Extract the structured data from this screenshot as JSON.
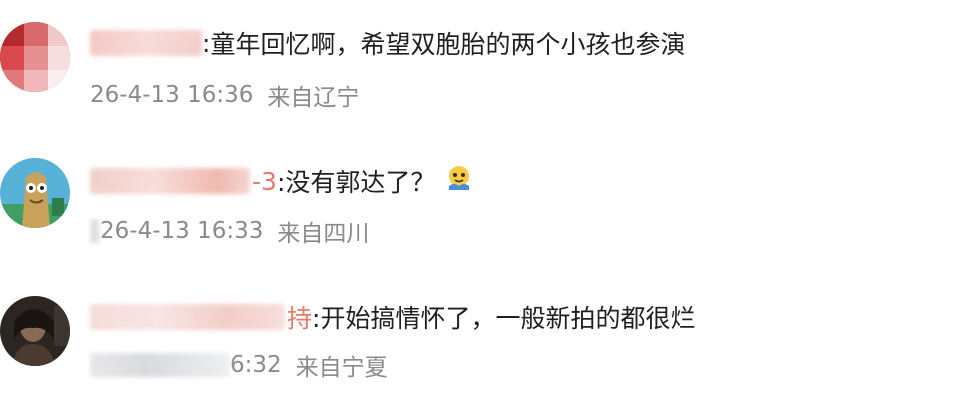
{
  "comments": [
    {
      "avatar_icon": "pink-mosaic-avatar",
      "name_suffix": ":",
      "text": "童年回忆啊，希望双胞胎的两个小孩也参演",
      "date": "26-4-13 16:36",
      "location": "来自辽宁"
    },
    {
      "avatar_icon": "cartoon-character-avatar",
      "name_suffix": "-3",
      "text": ":没有郭达了？",
      "emoji": "pleading-emoji",
      "date": "26-4-13 16:33",
      "location": "来自四川"
    },
    {
      "avatar_icon": "dark-photo-avatar",
      "name_suffix": "持",
      "text": ":开始搞情怀了，一般新拍的都很烂",
      "date": "6:32",
      "location": "来自宁夏"
    }
  ],
  "colors": {
    "text": "#1f1f1f",
    "meta": "#8a8a8a",
    "name_accent": "#e77a6a"
  }
}
